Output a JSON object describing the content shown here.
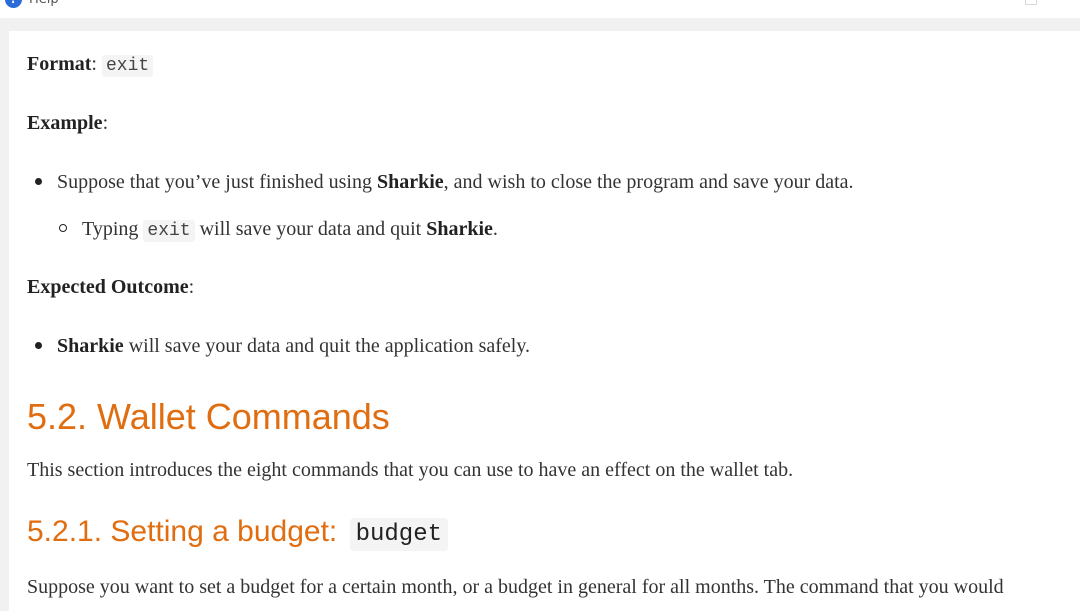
{
  "window": {
    "title": "Help",
    "help_glyph": "?",
    "icon": "help-icon"
  },
  "doc": {
    "format": {
      "label": "Format",
      "colon": ":",
      "code": "exit"
    },
    "example": {
      "label": "Example",
      "colon": ":"
    },
    "example_bullet": {
      "t1": "Suppose that you’ve just finished using ",
      "b1": "Sharkie",
      "t2": ", and wish to close the program and save your data."
    },
    "example_sub": {
      "t1": "Typing ",
      "code": "exit",
      "t2": " will save your data and quit ",
      "b1": "Sharkie",
      "t3": "."
    },
    "outcome": {
      "label": "Expected Outcome",
      "colon": ":"
    },
    "outcome_bullet": {
      "b1": "Sharkie",
      "t1": " will save your data and quit the application safely."
    },
    "section_heading": "5.2. Wallet Commands",
    "section_intro": "This section introduces the eight commands that you can use to have an effect on the wallet tab.",
    "subsection_heading": {
      "text": "5.2.1. Setting a budget: ",
      "code": "budget"
    },
    "subsection_para": "Suppose you want to set a budget for a certain month, or a budget in general for all months. The command that you would"
  },
  "colors": {
    "heading": "#e06d10",
    "text": "#333333",
    "code_bg": "#f4f4f4",
    "icon": "#2b6cd8"
  }
}
